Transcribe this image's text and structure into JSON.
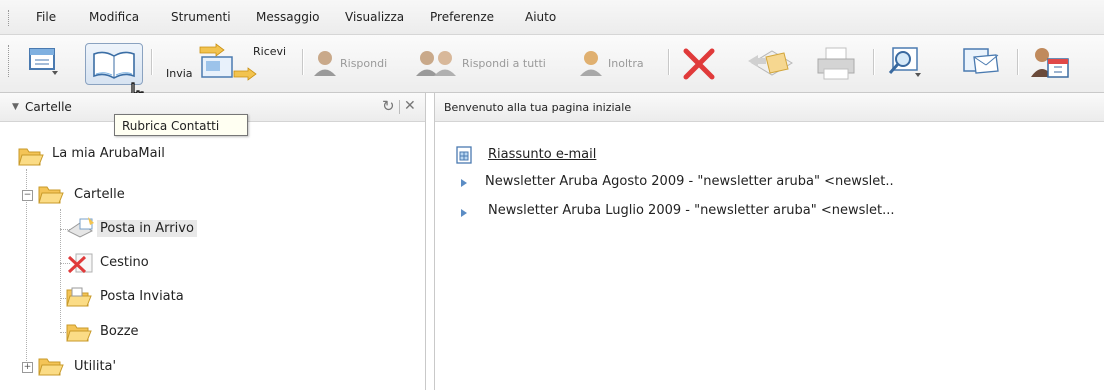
{
  "menu": [
    "File",
    "Modifica",
    "Strumenti",
    "Messaggio",
    "Visualizza",
    "Preferenze",
    "Aiuto"
  ],
  "toolbar": {
    "invia_label": "Invia",
    "ricevi_label": "Ricevi",
    "rispondi_label": "Rispondi",
    "rispondi_tutti_label": "Rispondi a tutti",
    "inoltra_label": "Inoltra"
  },
  "tooltip": "Rubrica Contatti",
  "folders_panel": {
    "title": "Cartelle",
    "root": "La mia ArubaMail",
    "cartelle": "Cartelle",
    "items": [
      "Posta in Arrivo",
      "Cestino",
      "Posta Inviata",
      "Bozze"
    ],
    "utilita": "Utilita'"
  },
  "home": {
    "header": "Benvenuto alla tua pagina iniziale",
    "summary": "Riassunto e-mail",
    "newsletters": [
      "Newsletter Aruba Agosto 2009 - \"newsletter aruba\" <newslet..",
      "Newsletter Aruba Luglio 2009 - \"newsletter aruba\" <newslet..."
    ]
  },
  "colors": {
    "folder": "#f4c457",
    "accent": "#5b8cc4",
    "delete": "#e03a3a"
  }
}
